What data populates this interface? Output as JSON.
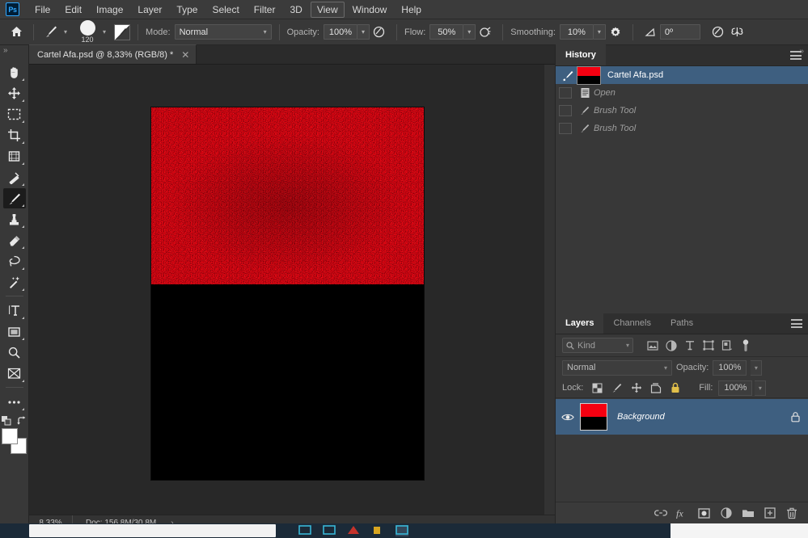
{
  "app": {
    "logo": "Ps"
  },
  "menubar": {
    "items": [
      {
        "label": "File",
        "active": false
      },
      {
        "label": "Edit",
        "active": false
      },
      {
        "label": "Image",
        "active": false
      },
      {
        "label": "Layer",
        "active": false
      },
      {
        "label": "Type",
        "active": false
      },
      {
        "label": "Select",
        "active": false
      },
      {
        "label": "Filter",
        "active": false
      },
      {
        "label": "3D",
        "active": false
      },
      {
        "label": "View",
        "active": true
      },
      {
        "label": "Window",
        "active": false
      },
      {
        "label": "Help",
        "active": false
      }
    ]
  },
  "options_bar": {
    "home_icon": "home-icon",
    "brush_preset_icon": "brush-icon",
    "brush_size": "120",
    "toggle_brush_panel_icon": "brush-settings-icon",
    "mode_label": "Mode:",
    "mode_value": "Normal",
    "opacity_label": "Opacity:",
    "opacity_value": "100%",
    "pressure_opacity_icon": "pressure-opacity-icon",
    "flow_label": "Flow:",
    "flow_value": "50%",
    "airbrush_icon": "airbrush-icon",
    "smoothing_label": "Smoothing:",
    "smoothing_value": "10%",
    "smoothing_options_icon": "gear-icon",
    "angle_label_icon": "angle-icon",
    "angle_value": "0º",
    "pressure_size_icon": "pressure-size-icon",
    "symmetry_icon": "symmetry-butterfly-icon"
  },
  "toolbar": {
    "collapse_label": "»",
    "tools": [
      {
        "name": "hand-tool",
        "icon": "hand-icon",
        "active": false
      },
      {
        "name": "move-tool",
        "icon": "move-icon",
        "active": false
      },
      {
        "name": "rectangular-marquee-tool",
        "icon": "marquee-icon",
        "active": false
      },
      {
        "name": "crop-tool",
        "icon": "crop-icon",
        "active": false
      },
      {
        "name": "frame-tool",
        "icon": "frame-icon",
        "active": false
      },
      {
        "name": "eyedropper-tool",
        "icon": "eyedropper-icon",
        "active": false
      },
      {
        "name": "brush-tool",
        "icon": "brush-icon",
        "active": true
      },
      {
        "name": "clone-stamp-tool",
        "icon": "stamp-icon",
        "active": false
      },
      {
        "name": "eraser-tool",
        "icon": "eraser-icon",
        "active": false
      },
      {
        "name": "lasso-tool",
        "icon": "lasso-icon",
        "active": false
      },
      {
        "name": "magic-wand-tool",
        "icon": "wand-icon",
        "active": false
      },
      {
        "name": "type-tool",
        "icon": "type-icon",
        "active": false
      },
      {
        "name": "shape-tool",
        "icon": "rectangle-icon",
        "active": false
      },
      {
        "name": "zoom-tool",
        "icon": "magnifier-icon",
        "active": false
      },
      {
        "name": "gradient-tool",
        "icon": "gradient-icon",
        "active": false
      },
      {
        "name": "edit-toolbar",
        "icon": "ellipsis-icon",
        "active": false
      }
    ],
    "default_colors_icon": "default-colors-icon",
    "swap_colors_icon": "swap-colors-icon",
    "foreground_color": "#ffffff",
    "background_color": "#ffffff"
  },
  "document": {
    "tab_title": "Cartel Afa.psd @ 8,33% (RGB/8) *",
    "close_icon": "close-icon"
  },
  "status_bar": {
    "zoom": "8,33%",
    "doc_info": "Doc: 156,8M/30,8M",
    "expand_arrow": "›"
  },
  "right_panels": {
    "collapse_label": "»",
    "history": {
      "tabs": [
        {
          "label": "History",
          "active": true
        }
      ],
      "menu_icon": "panel-menu-icon",
      "entries": [
        {
          "label": "Cartel Afa.psd",
          "icon": "snapshot-icon",
          "thumbnail": true,
          "selected": true,
          "italic": false
        },
        {
          "label": "Open",
          "icon": "document-icon",
          "thumbnail": false,
          "selected": false,
          "italic": true
        },
        {
          "label": "Brush Tool",
          "icon": "brush-icon",
          "thumbnail": false,
          "selected": false,
          "italic": true
        },
        {
          "label": "Brush Tool",
          "icon": "brush-icon",
          "thumbnail": false,
          "selected": false,
          "italic": true
        }
      ],
      "footer_icons": [
        {
          "name": "new-document-from-state-icon"
        },
        {
          "name": "new-snapshot-camera-icon"
        },
        {
          "name": "delete-state-trash-icon"
        }
      ]
    },
    "layers": {
      "tabs": [
        {
          "label": "Layers",
          "active": true
        },
        {
          "label": "Channels",
          "active": false
        },
        {
          "label": "Paths",
          "active": false
        }
      ],
      "menu_icon": "panel-menu-icon",
      "filter": {
        "kind_label": "Kind",
        "search_icon": "search-icon",
        "chevron_icon": "chevron-down-icon",
        "type_filters": [
          {
            "name": "filter-pixel-layers-icon"
          },
          {
            "name": "filter-adjustment-layers-icon"
          },
          {
            "name": "filter-type-layers-icon"
          },
          {
            "name": "filter-shape-layers-icon"
          },
          {
            "name": "filter-smart-object-layers-icon"
          }
        ],
        "toggle_icon": "filter-toggle-switch-icon"
      },
      "blend_mode": "Normal",
      "opacity_label": "Opacity:",
      "opacity_value": "100%",
      "lock_label": "Lock:",
      "lock_icons": [
        {
          "name": "lock-transparent-pixels-icon"
        },
        {
          "name": "lock-image-pixels-icon"
        },
        {
          "name": "lock-position-icon"
        },
        {
          "name": "lock-artboard-nesting-icon"
        },
        {
          "name": "lock-all-icon"
        }
      ],
      "fill_label": "Fill:",
      "fill_value": "100%",
      "rows": [
        {
          "name": "Background",
          "visible": true,
          "locked": true,
          "selected": true
        }
      ],
      "footer_icons": [
        {
          "name": "link-layers-icon"
        },
        {
          "name": "layer-style-fx-icon"
        },
        {
          "name": "add-layer-mask-icon"
        },
        {
          "name": "new-adjustment-layer-icon"
        },
        {
          "name": "new-group-icon"
        },
        {
          "name": "new-layer-icon"
        },
        {
          "name": "delete-layer-trash-icon"
        }
      ]
    }
  },
  "canvas": {
    "artboard_top_color": "#fa0014",
    "artboard_bottom_color": "#000000"
  },
  "taskbar": {
    "search_placeholder": "",
    "apps": [
      {
        "name": "taskbar-app-1",
        "active": false
      },
      {
        "name": "taskbar-app-2",
        "active": false
      },
      {
        "name": "taskbar-app-3",
        "active": false
      },
      {
        "name": "taskbar-app-4",
        "active": false
      },
      {
        "name": "taskbar-app-photoshop",
        "active": true
      }
    ]
  }
}
